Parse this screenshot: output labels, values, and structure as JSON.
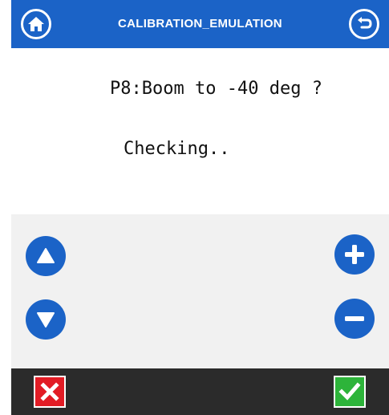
{
  "header": {
    "title": "CALIBRATION_EMULATION",
    "home_icon": "home-icon",
    "back_icon": "undo-arrow-icon"
  },
  "main": {
    "prompt": "P8:Boom to -40 deg ?",
    "status": "Checking.."
  },
  "controls": {
    "up_icon": "triangle-up-icon",
    "down_icon": "triangle-down-icon",
    "plus_icon": "plus-icon",
    "minus_icon": "minus-icon"
  },
  "footer": {
    "cancel_icon": "x-icon",
    "confirm_icon": "check-icon"
  },
  "colors": {
    "accent": "#1b63c7",
    "controls_bg": "#f1f1f1",
    "footer_bg": "#2b2b2b",
    "cancel": "#e21c25",
    "confirm": "#2db43a"
  }
}
